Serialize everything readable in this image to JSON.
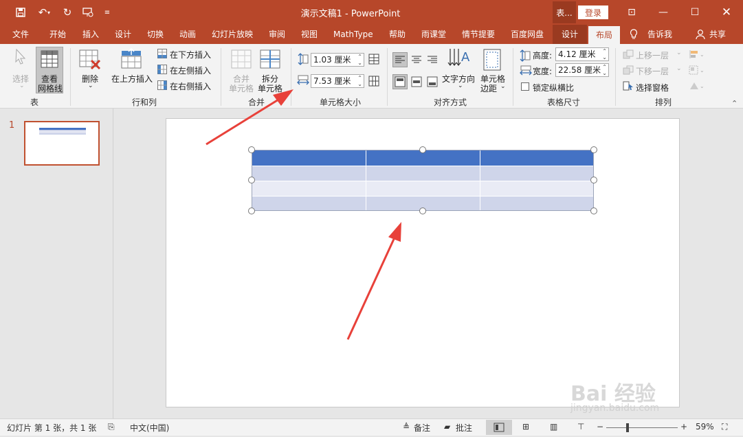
{
  "window": {
    "title": "演示文稿1 - PowerPoint",
    "context_tab": "表...",
    "login": "登录"
  },
  "tabs": [
    "文件",
    "开始",
    "插入",
    "设计",
    "切换",
    "动画",
    "幻灯片放映",
    "审阅",
    "视图",
    "MathType",
    "帮助",
    "雨课堂",
    "情节提要",
    "百度网盘"
  ],
  "context_tabs": {
    "design": "设计",
    "layout": "布局"
  },
  "tell_me": "告诉我",
  "share": "共享",
  "ribbon": {
    "table_group": {
      "label": "表",
      "select": "选择",
      "view_gridlines": [
        "查看",
        "网格线"
      ]
    },
    "rows_cols_group": {
      "label": "行和列",
      "delete": "删除",
      "insert_above": "在上方插入",
      "insert_below": "在下方插入",
      "insert_left": "在左侧插入",
      "insert_right": "在右侧插入"
    },
    "merge_group": {
      "label": "合并",
      "merge_cells": [
        "合并",
        "单元格"
      ],
      "split_cells": [
        "拆分",
        "单元格"
      ]
    },
    "cell_size_group": {
      "label": "单元格大小",
      "height": "1.03 厘米",
      "width": "7.53 厘米"
    },
    "alignment_group": {
      "label": "对齐方式",
      "text_direction": "文字方向",
      "cell_margins": [
        "单元格",
        "边距"
      ]
    },
    "table_size_group": {
      "label": "表格尺寸",
      "height_label": "高度:",
      "height_value": "4.12 厘米",
      "width_label": "宽度:",
      "width_value": "22.58 厘米",
      "lock_aspect": "锁定纵横比"
    },
    "arrange_group": {
      "label": "排列",
      "bring_forward": "上移一层",
      "send_backward": "下移一层",
      "selection_pane": "选择窗格"
    }
  },
  "thumbnail": {
    "number": "1"
  },
  "status": {
    "slide_info": "幻灯片 第 1 张，共 1 张",
    "language": "中文(中国)",
    "notes": "备注",
    "comments": "批注",
    "zoom": "59%"
  },
  "watermark": {
    "text": "Bai 经验",
    "url": "jingyan.baidu.com"
  },
  "colors": {
    "accent": "#b7472a",
    "header_row": "#4472c4",
    "band_dark": "#cfd5ea",
    "band_light": "#e9ebf5",
    "arrow": "#e8413a"
  }
}
